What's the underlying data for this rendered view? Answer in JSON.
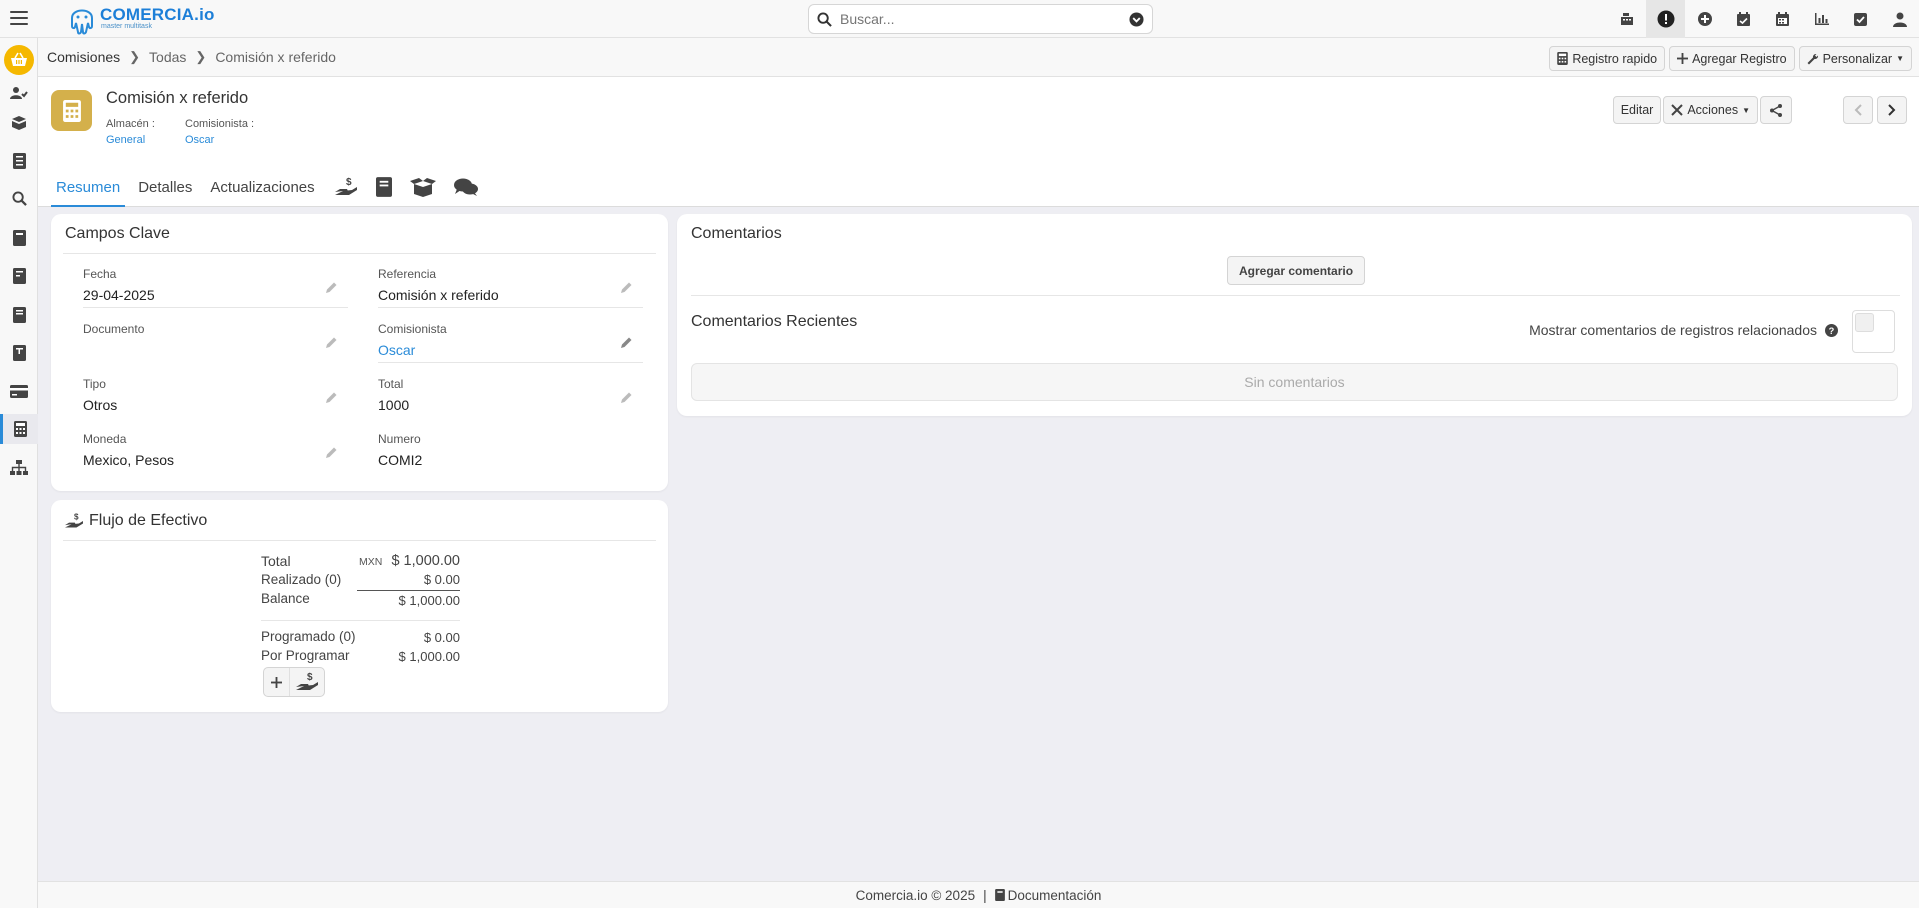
{
  "app": {
    "brand": "COMERCIA.io",
    "brand_tagline": "master multitask"
  },
  "search": {
    "placeholder": "Buscar..."
  },
  "breadcrumb": {
    "section": "Comisiones",
    "list": "Todas",
    "current": "Comisión x referido"
  },
  "toolbar": {
    "quick_record": "Registro rapido",
    "add_record": "Agregar Registro",
    "customize": "Personalizar"
  },
  "record": {
    "title": "Comisión x referido",
    "almacen_label": "Almacén :",
    "almacen_value": "General",
    "comisionista_label": "Comisionista :",
    "comisionista_value": "Oscar"
  },
  "actions": {
    "edit": "Editar",
    "actions": "Acciones"
  },
  "tabs": [
    "Resumen",
    "Detalles",
    "Actualizaciones"
  ],
  "key_fields": {
    "title": "Campos Clave",
    "fecha_label": "Fecha",
    "fecha_value": "29-04-2025",
    "referencia_label": "Referencia",
    "referencia_value": "Comisión x referido",
    "documento_label": "Documento",
    "documento_value": "",
    "comisionista_label": "Comisionista",
    "comisionista_value": "Oscar",
    "tipo_label": "Tipo",
    "tipo_value": "Otros",
    "total_label": "Total",
    "total_value": "1000",
    "moneda_label": "Moneda",
    "moneda_value": "Mexico, Pesos",
    "numero_label": "Numero",
    "numero_value": "COMI2"
  },
  "cash_flow": {
    "title": "Flujo de Efectivo",
    "total_label": "Total",
    "currency": "MXN",
    "total_value": "$ 1,000.00",
    "realizado_label": "Realizado (0)",
    "realizado_value": "$ 0.00",
    "balance_label": "Balance",
    "balance_value": "$ 1,000.00",
    "programado_label": "Programado (0)",
    "programado_value": "$ 0.00",
    "por_programar_label": "Por Programar",
    "por_programar_value": "$ 1,000.00"
  },
  "comments": {
    "title": "Comentarios",
    "add_button": "Agregar comentario",
    "recent_title": "Comentarios Recientes",
    "show_related_label": "Mostrar comentarios de registros relacionados",
    "empty": "Sin comentarios"
  },
  "footer": {
    "copyright": "Comercia.io © 2025",
    "separator": "|",
    "docs": "Documentación"
  },
  "colors": {
    "accent": "#2a8bd8",
    "record_icon": "#d4b04b",
    "home": "#f5b800"
  }
}
